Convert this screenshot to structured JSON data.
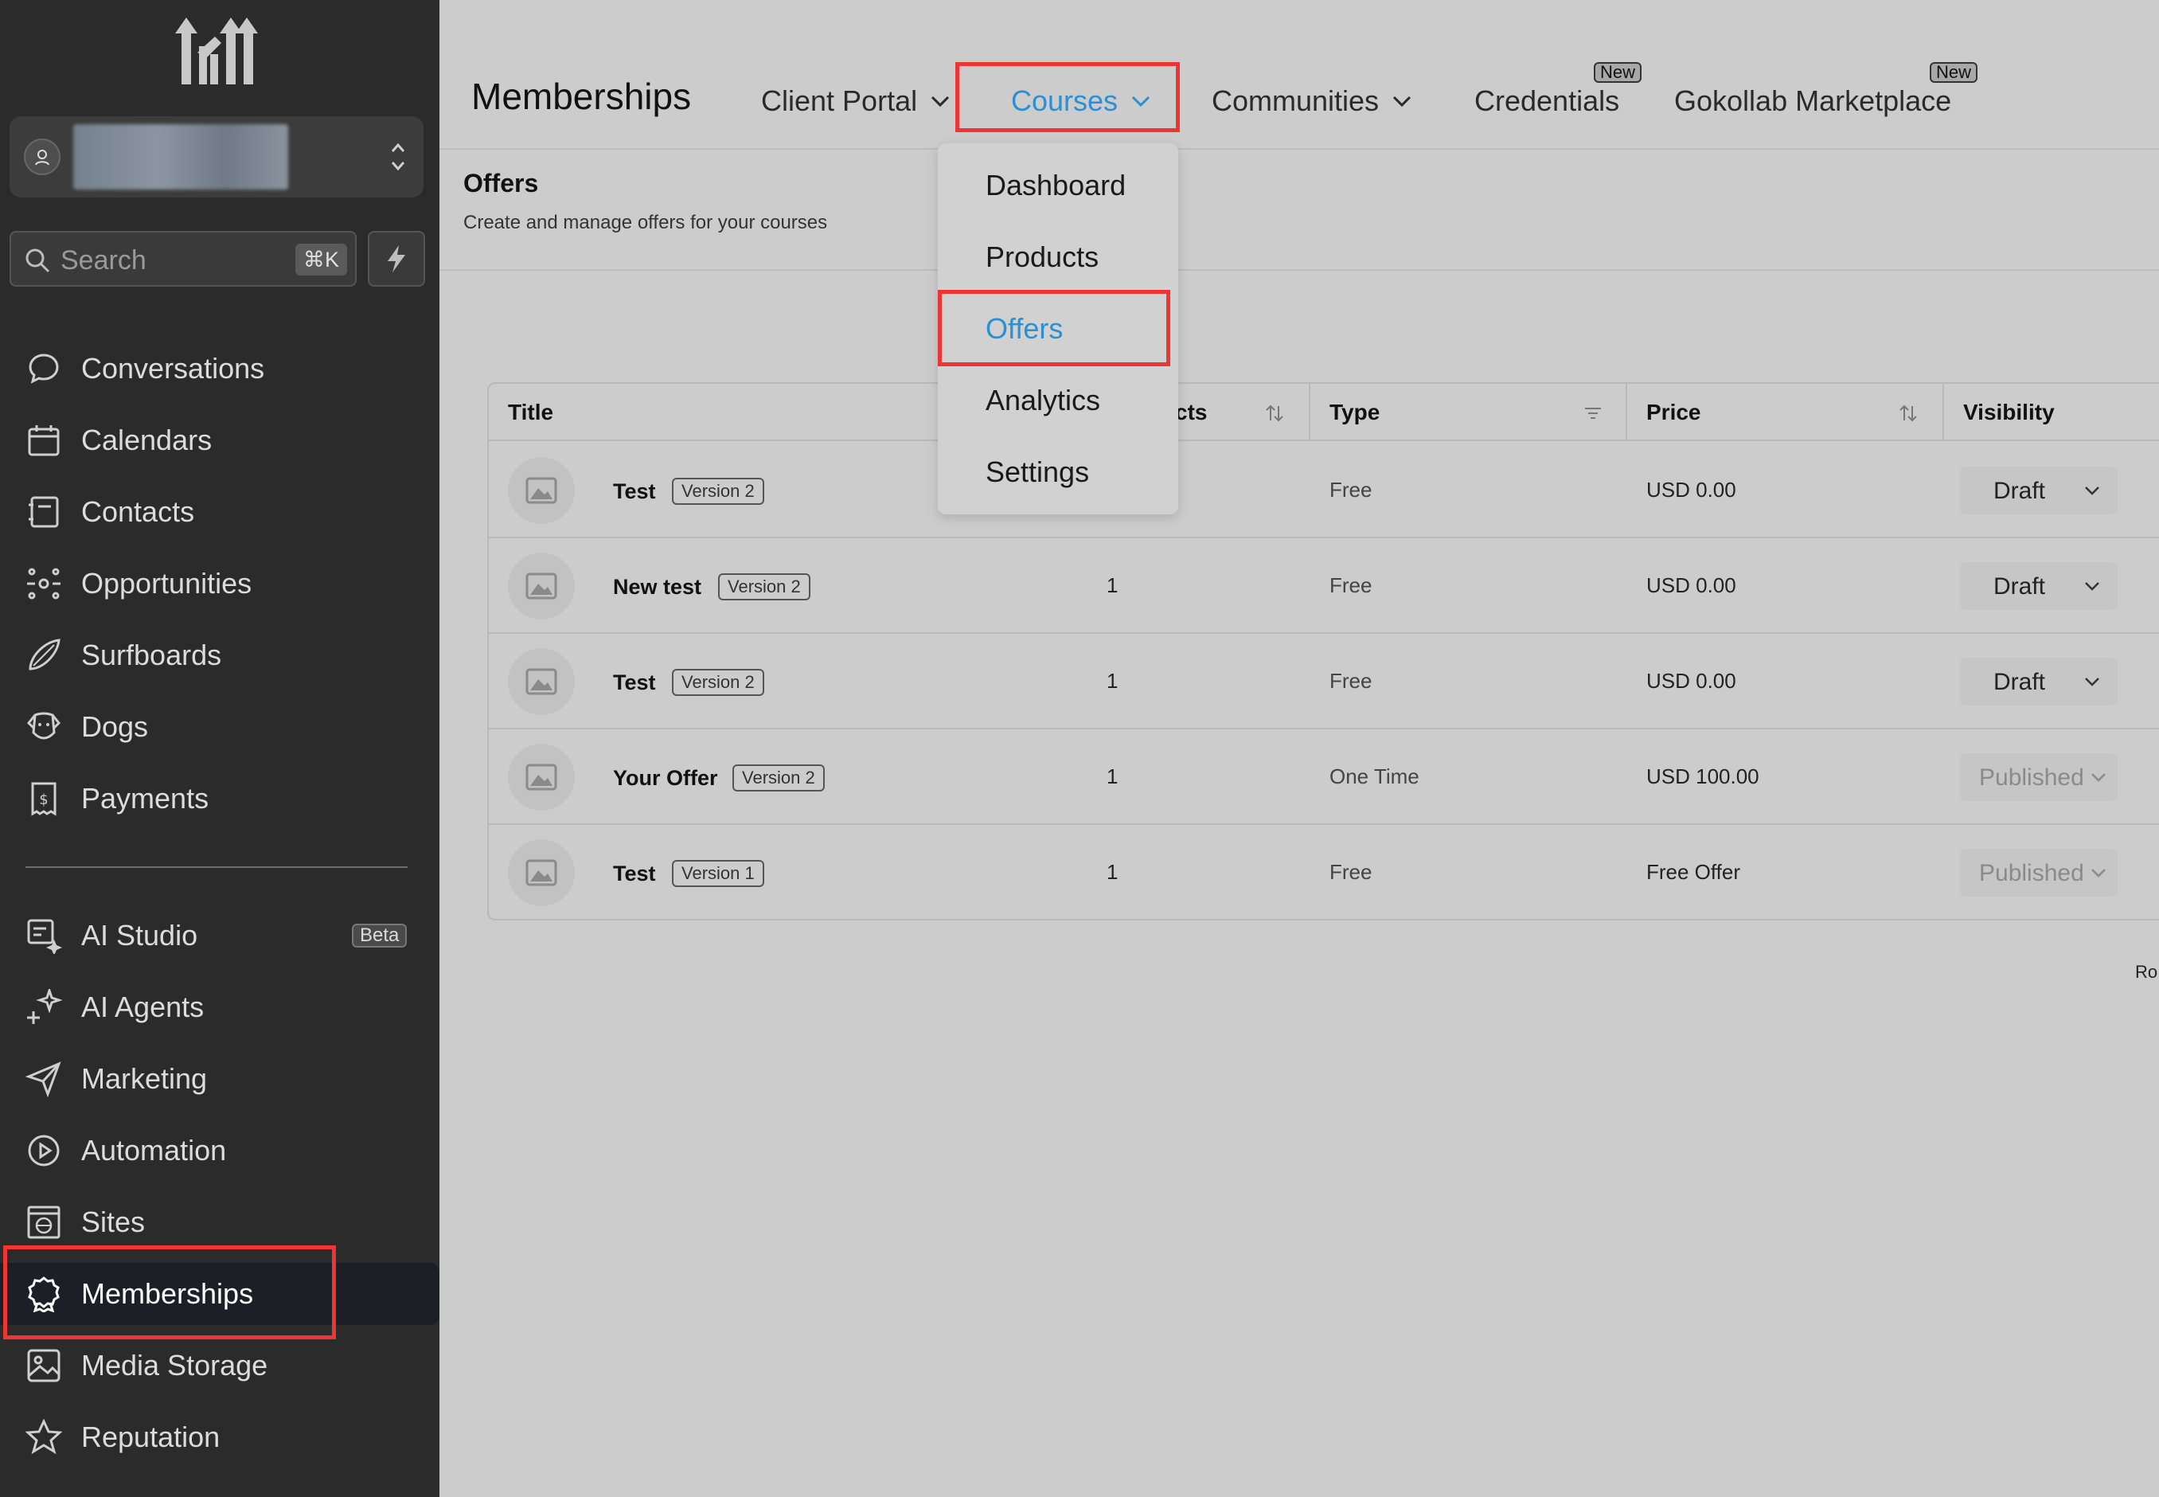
{
  "sidebar": {
    "search": {
      "placeholder": "Search",
      "shortcut": "⌘K"
    },
    "items": [
      {
        "label": "Conversations",
        "icon": "chat-bubble-icon"
      },
      {
        "label": "Calendars",
        "icon": "calendar-icon"
      },
      {
        "label": "Contacts",
        "icon": "contacts-icon"
      },
      {
        "label": "Opportunities",
        "icon": "opportunities-icon"
      },
      {
        "label": "Surfboards",
        "icon": "surfboard-icon"
      },
      {
        "label": "Dogs",
        "icon": "dog-icon"
      },
      {
        "label": "Payments",
        "icon": "payments-icon"
      }
    ],
    "items2": [
      {
        "label": "AI Studio",
        "icon": "ai-studio-icon",
        "badge": "Beta"
      },
      {
        "label": "AI Agents",
        "icon": "sparkle-icon"
      },
      {
        "label": "Marketing",
        "icon": "send-icon"
      },
      {
        "label": "Automation",
        "icon": "play-circle-icon"
      },
      {
        "label": "Sites",
        "icon": "globe-window-icon"
      },
      {
        "label": "Memberships",
        "icon": "badge-icon",
        "active": true
      },
      {
        "label": "Media Storage",
        "icon": "image-icon"
      },
      {
        "label": "Reputation",
        "icon": "star-icon"
      }
    ]
  },
  "topnav": {
    "title": "Memberships",
    "tabs": [
      {
        "label": "Client Portal"
      },
      {
        "label": "Courses",
        "active": true
      },
      {
        "label": "Communities"
      },
      {
        "label": "Credentials",
        "badge": "New"
      },
      {
        "label": "Gokollab Marketplace",
        "badge": "New"
      }
    ]
  },
  "courses_menu": [
    "Dashboard",
    "Products",
    "Offers",
    "Analytics",
    "Settings"
  ],
  "offers": {
    "title": "Offers",
    "subtitle": "Create and manage offers for your courses"
  },
  "table": {
    "headers": {
      "title": "Title",
      "products": "cts",
      "type": "Type",
      "price": "Price",
      "visibility": "Visibility"
    },
    "rows": [
      {
        "title": "Test",
        "version": "Version 2",
        "products": "",
        "type": "Free",
        "price": "USD 0.00",
        "visibility": "Draft"
      },
      {
        "title": "New test",
        "version": "Version 2",
        "products": "1",
        "type": "Free",
        "price": "USD 0.00",
        "visibility": "Draft"
      },
      {
        "title": "Test",
        "version": "Version 2",
        "products": "1",
        "type": "Free",
        "price": "USD 0.00",
        "visibility": "Draft"
      },
      {
        "title": "Your Offer",
        "version": "Version 2",
        "products": "1",
        "type": "One Time",
        "price": "USD 100.00",
        "visibility": "Published"
      },
      {
        "title": "Test",
        "version": "Version 1",
        "products": "1",
        "type": "Free",
        "price": "Free Offer",
        "visibility": "Published"
      }
    ]
  },
  "footer_clip": "Ro",
  "colors": {
    "accent": "#2a8fd4",
    "highlight": "#ef3434",
    "sidebar_bg": "#2b2b2b"
  }
}
